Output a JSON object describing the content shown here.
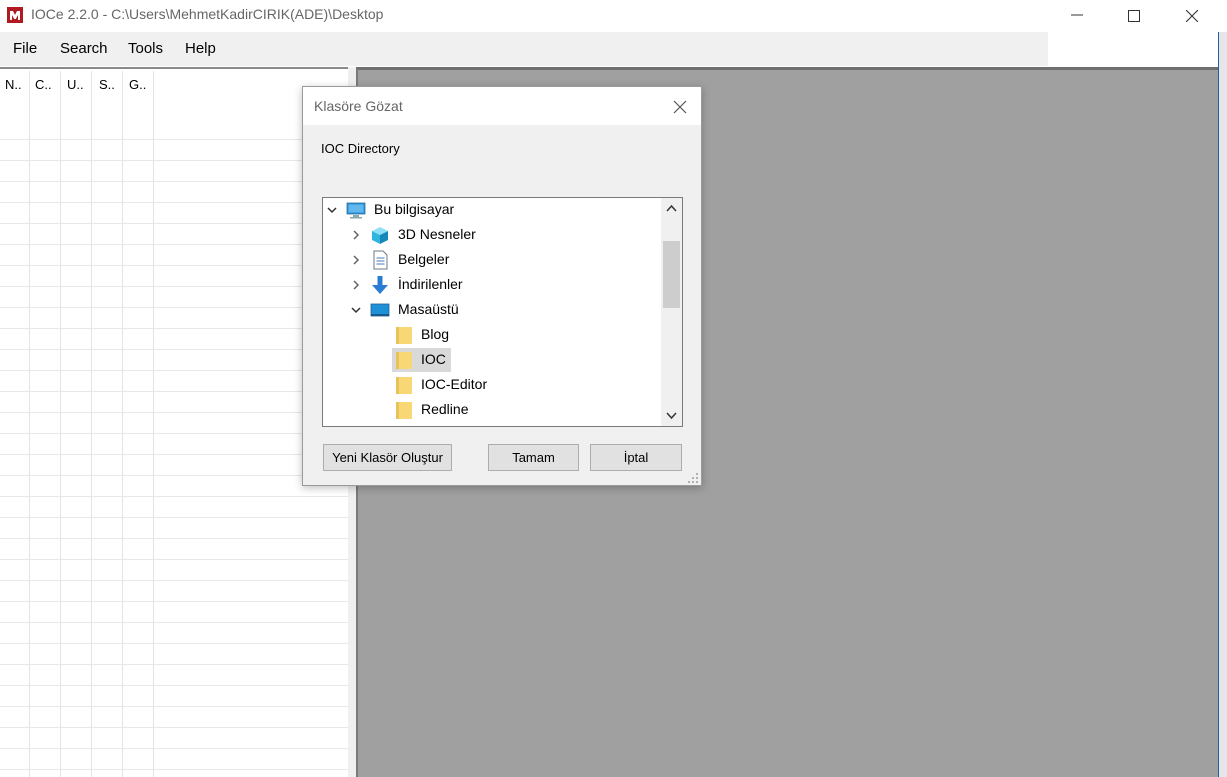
{
  "window": {
    "title": "IOCe 2.2.0 - C:\\Users\\MehmetKadirCIRIK(ADE)\\Desktop",
    "logo_icon": "ioce-logo-icon",
    "controls": [
      "minimize-icon",
      "maximize-icon",
      "close-icon"
    ]
  },
  "menu": {
    "items": [
      "File",
      "Search",
      "Tools",
      "Help"
    ]
  },
  "list": {
    "columns": [
      "N..",
      "C..",
      "U..",
      "S..",
      "G.."
    ]
  },
  "dialog": {
    "title": "Klasöre Gözat",
    "description": "IOC Directory",
    "tree": [
      {
        "label": "Bu bilgisayar",
        "icon": "computer-icon",
        "expanded": true
      },
      {
        "label": "3D Nesneler",
        "icon": "3d-objects-icon",
        "expanded": false
      },
      {
        "label": "Belgeler",
        "icon": "documents-icon",
        "expanded": false
      },
      {
        "label": "İndirilenler",
        "icon": "downloads-icon",
        "expanded": false
      },
      {
        "label": "Masaüstü",
        "icon": "desktop-icon",
        "expanded": true
      },
      {
        "label": "Blog",
        "icon": "folder-icon"
      },
      {
        "label": "IOC",
        "icon": "folder-icon",
        "selected": true
      },
      {
        "label": "IOC-Editor",
        "icon": "folder-icon"
      },
      {
        "label": "Redline",
        "icon": "folder-icon"
      }
    ],
    "buttons": {
      "new_folder": "Yeni Klasör Oluştur",
      "ok": "Tamam",
      "cancel": "İptal"
    }
  },
  "colors": {
    "logo_red": "#b01b22",
    "gray_pane": "#a0a0a0",
    "selection": "#d9d9d9",
    "folder_yellow": "#f8d775",
    "computer_blue": "#1e90d8",
    "download_blue": "#2b7cd3"
  }
}
